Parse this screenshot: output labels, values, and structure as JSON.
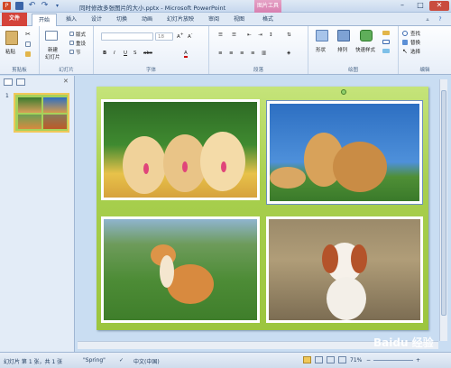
{
  "titlebar": {
    "title": "同时修改多张图片的大小.pptx - Microsoft PowerPoint",
    "context_tab": "图片工具",
    "minimize": "–",
    "maximize": "□",
    "close": "✕"
  },
  "tabs": [
    "文件",
    "开始",
    "插入",
    "设计",
    "切换",
    "动画",
    "幻灯片放映",
    "审阅",
    "视图",
    "格式"
  ],
  "ribbon": {
    "groups": {
      "clipboard": "剪贴板",
      "slides": "幻灯片",
      "font": "字体",
      "paragraph": "段落",
      "drawing": "绘图",
      "editing": "编辑"
    },
    "paste_label": "粘贴",
    "new_slide_label": "新建",
    "new_slide_label2": "幻灯片",
    "layout_label": "版式",
    "reset_label": "重设",
    "section_label": "节",
    "font_size": "18",
    "shapes_label": "形状",
    "arrange_label": "排列",
    "quick_styles_label": "快速样式",
    "find_label": "查找",
    "replace_label": "替换",
    "select_label": "选择"
  },
  "slides_panel": {
    "slide_number": "1"
  },
  "status": {
    "slide_info": "幻灯片 第 1 张，共 1 张",
    "theme": "\"Spring\"",
    "language": "中文(中国)",
    "zoom": "71%",
    "watermark": "Baidu 经验"
  },
  "colors": {
    "file_tab": "#d4433a",
    "context_tab": "#d77fb0",
    "slide_bg": "#a8cf4e",
    "ribbon_border": "#9fb6d3"
  }
}
